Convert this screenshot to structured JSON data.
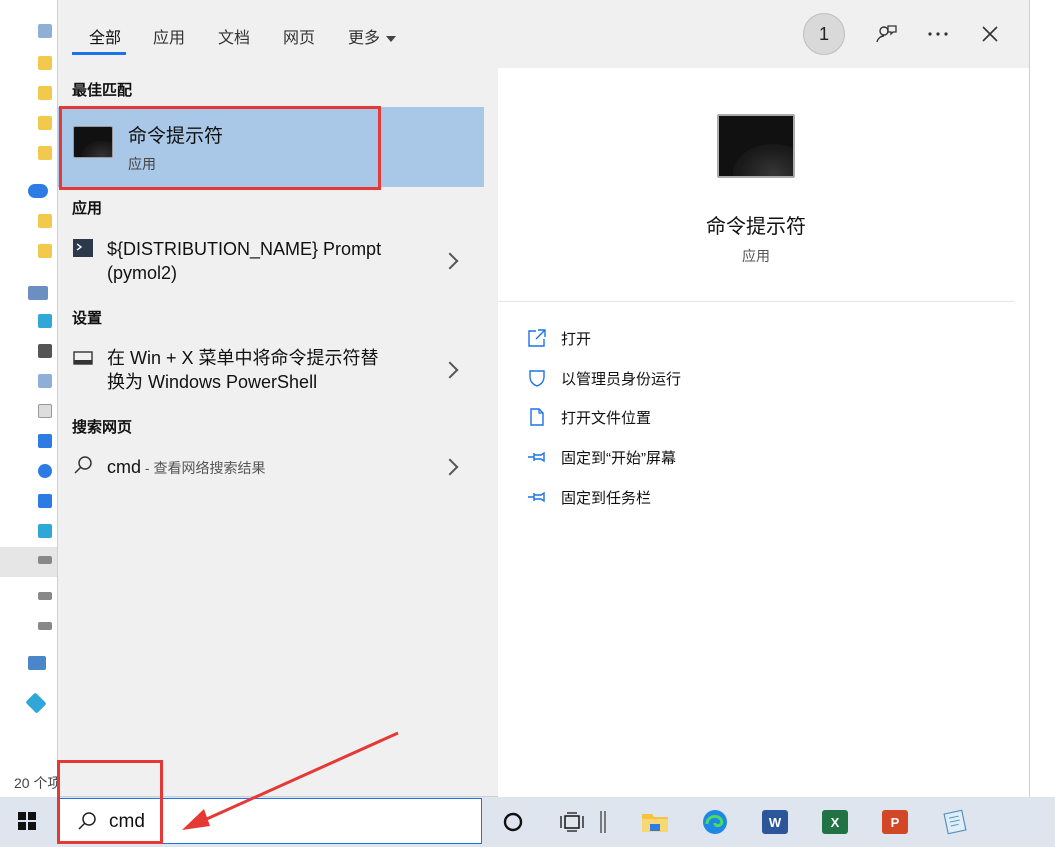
{
  "tabs": [
    {
      "label": "全部"
    },
    {
      "label": "应用"
    },
    {
      "label": "文档"
    },
    {
      "label": "网页"
    },
    {
      "label": "更多"
    }
  ],
  "header": {
    "badge_count": "1",
    "feedback_icon": "feedback-icon",
    "more_icon": "ellipsis-icon",
    "close_icon": "close-icon"
  },
  "sections": {
    "best_match": "最佳匹配",
    "apps": "应用",
    "settings": "设置",
    "web": "搜索网页"
  },
  "best_match": {
    "title": "命令提示符",
    "subtitle": "应用"
  },
  "apps": [
    {
      "line1": "${DISTRIBUTION_NAME} Prompt",
      "line2": "(pymol2)"
    }
  ],
  "settings": [
    {
      "line1": "在 Win + X 菜单中将命令提示符替",
      "line2": "换为 Windows PowerShell"
    }
  ],
  "web": [
    {
      "query": "cmd",
      "suffix": " - 查看网络搜索结果"
    }
  ],
  "preview": {
    "title": "命令提示符",
    "subtitle": "应用",
    "actions": [
      {
        "label": "打开",
        "icon": "open-icon"
      },
      {
        "label": "以管理员身份运行",
        "icon": "shield-icon"
      },
      {
        "label": "打开文件位置",
        "icon": "file-location-icon"
      },
      {
        "label": "固定到“开始”屏幕",
        "icon": "pin-icon"
      },
      {
        "label": "固定到任务栏",
        "icon": "pin-icon"
      }
    ]
  },
  "background": {
    "item_count": "20 个项"
  },
  "taskbar": {
    "search_value": "cmd",
    "apps": [
      "cortana-icon",
      "task-view-icon",
      "file-explorer-icon",
      "edge-icon",
      "word-icon",
      "excel-icon",
      "powerpoint-icon",
      "notepad-icon"
    ],
    "word_letter": "W",
    "excel_letter": "X",
    "powerpoint_letter": "P"
  },
  "colors": {
    "accent": "#1a73e8",
    "selection": "#a9c8e8",
    "annotation": "#e53935"
  }
}
